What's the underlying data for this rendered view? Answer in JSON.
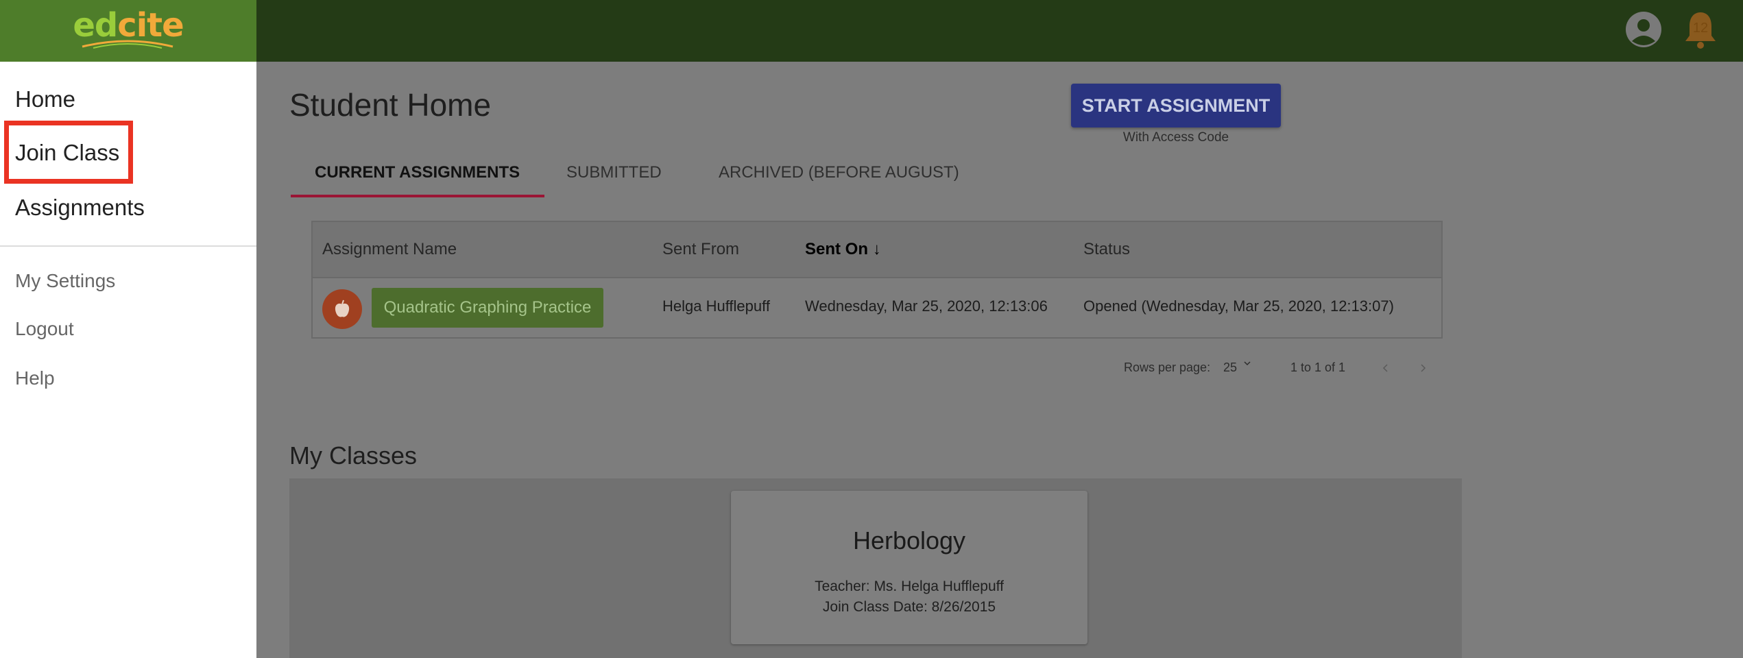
{
  "app": {
    "logo_text_ed": "ed",
    "logo_text_cite": "cite",
    "notification_count": "12",
    "colors": {
      "brand_green": "#4e7d2a",
      "topbar": "#243b16",
      "highlight": "#ea3323",
      "accent_tab": "#9b1535",
      "button_primary": "#2a3480"
    }
  },
  "sidebar": {
    "main_items": [
      {
        "label": "Home"
      },
      {
        "label": "Join Class"
      },
      {
        "label": "Assignments"
      }
    ],
    "secondary_items": [
      {
        "label": "My Settings"
      },
      {
        "label": "Logout"
      },
      {
        "label": "Help"
      }
    ]
  },
  "main": {
    "title": "Student Home",
    "start_button": {
      "label": "START ASSIGNMENT",
      "sublabel": "With Access Code"
    },
    "tabs": [
      {
        "label": "CURRENT ASSIGNMENTS",
        "active": true
      },
      {
        "label": "SUBMITTED",
        "active": false
      },
      {
        "label": "ARCHIVED (BEFORE AUGUST)",
        "active": false
      }
    ],
    "table": {
      "columns": [
        "Assignment Name",
        "Sent From",
        "Sent On",
        "Status"
      ],
      "sort_indicator": "↓",
      "rows": [
        {
          "icon": "apple-icon",
          "assignment": "Quadratic Graphing Practice",
          "sent_from": "Helga Hufflepuff",
          "sent_on": "Wednesday, Mar 25, 2020, 12:13:06",
          "status": "Opened (Wednesday, Mar 25, 2020, 12:13:07)"
        }
      ]
    },
    "pagination": {
      "rows_per_page_label": "Rows per page:",
      "rows_per_page_value": "25",
      "range": "1 to 1 of 1"
    },
    "classes": {
      "title": "My Classes",
      "cards": [
        {
          "name": "Herbology",
          "teacher": "Teacher: Ms. Helga Hufflepuff",
          "join_date": "Join Class Date: 8/26/2015"
        }
      ]
    }
  }
}
